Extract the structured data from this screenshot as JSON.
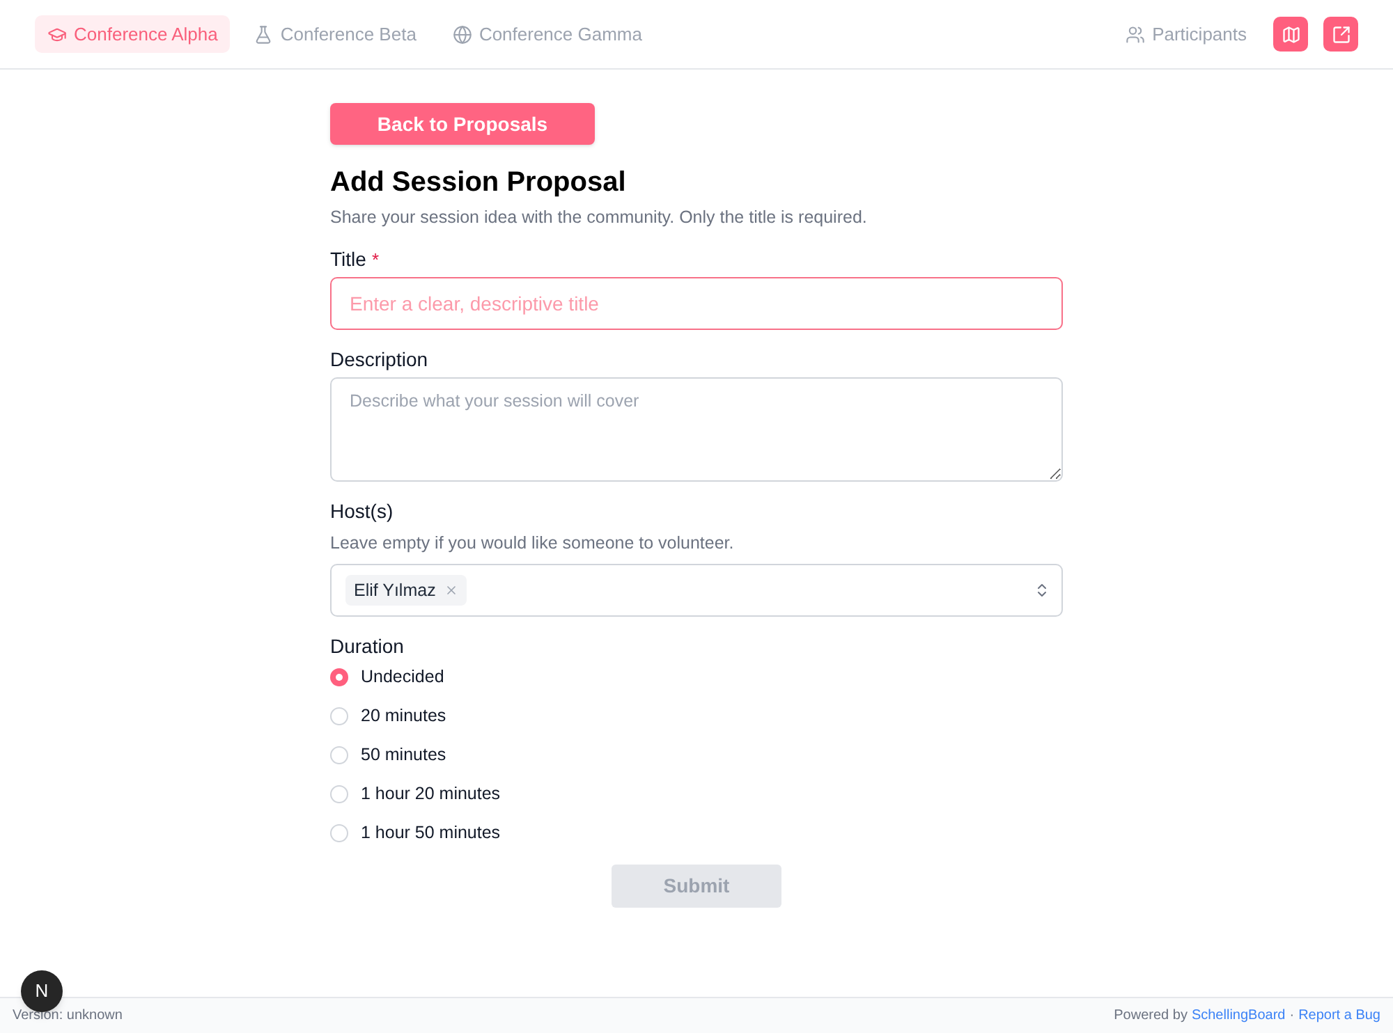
{
  "nav": {
    "tabs": [
      {
        "label": "Conference Alpha",
        "selected": true
      },
      {
        "label": "Conference Beta",
        "selected": false
      },
      {
        "label": "Conference Gamma",
        "selected": false
      }
    ],
    "participants_link": "Participants"
  },
  "back_button": "Back to Proposals",
  "heading": "Add Session Proposal",
  "intro": "Share your session idea with the community. Only the title is required.",
  "form": {
    "title": {
      "label": "Title",
      "required_mark": "*",
      "placeholder": "Enter a clear, descriptive title",
      "focused": true
    },
    "description": {
      "label": "Description",
      "placeholder": "Describe what your session will cover"
    },
    "hosts": {
      "label": "Host(s)",
      "hint": "Leave empty if you would like someone to volunteer.",
      "chips": [
        "Elif Yılmaz"
      ]
    },
    "duration": {
      "label": "Duration",
      "options": [
        {
          "label": "Undecided",
          "selected": true
        },
        {
          "label": "20 minutes",
          "selected": false
        },
        {
          "label": "50 minutes",
          "selected": false
        },
        {
          "label": "1 hour 20 minutes",
          "selected": false
        },
        {
          "label": "1 hour 50 minutes",
          "selected": false
        }
      ]
    },
    "submit": {
      "label": "Submit",
      "disabled": true
    }
  },
  "dev_badge": "N",
  "footer": {
    "version": "Version: unknown",
    "powered_by": "Powered by",
    "brand_link": "SchellingBoard",
    "separator": "·",
    "bug_link": "Report a Bug"
  }
}
